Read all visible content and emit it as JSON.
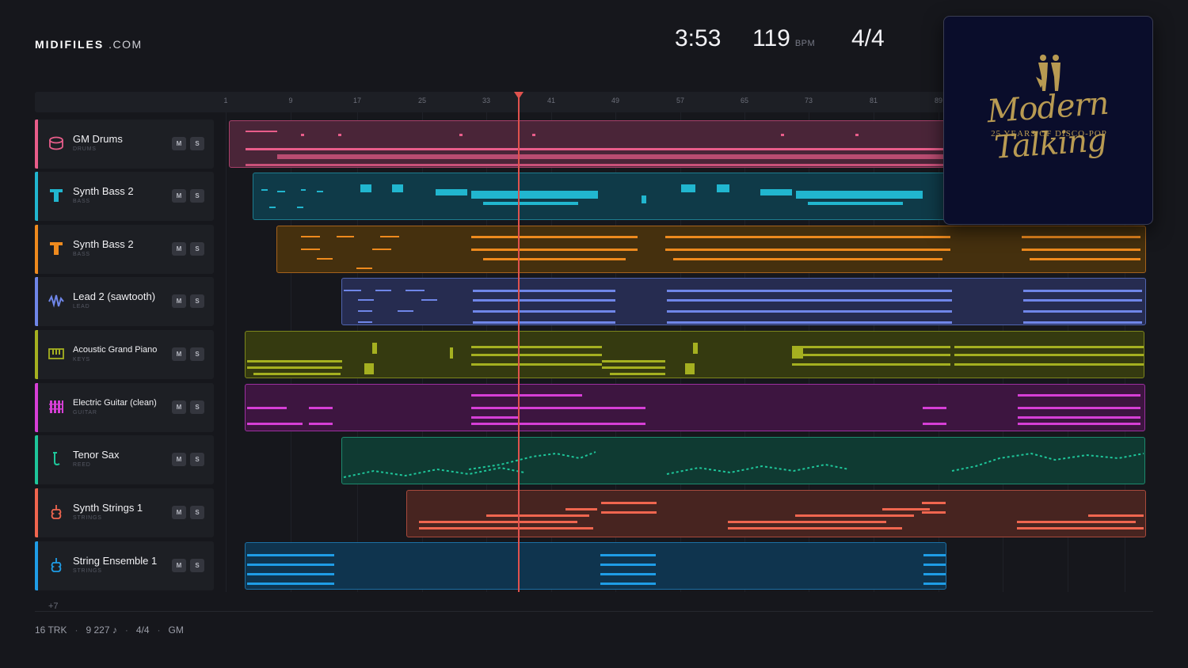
{
  "brand": {
    "name": "MIDIFILES",
    "domain": ".COM"
  },
  "song": {
    "duration": "3:53",
    "bpm": "119",
    "bpm_unit": "BPM",
    "time_signature": "4/4"
  },
  "ruler": {
    "bars": [
      "1",
      "9",
      "17",
      "25",
      "33",
      "41",
      "49",
      "57",
      "65",
      "73",
      "81",
      "89"
    ]
  },
  "tracks": [
    {
      "name": "GM Drums",
      "category": "DRUMS",
      "color": "#e85d8a",
      "icon": "drum-icon"
    },
    {
      "name": "Synth Bass 2",
      "category": "BASS",
      "color": "#21b6cf",
      "icon": "bass-icon"
    },
    {
      "name": "Synth Bass 2",
      "category": "BASS",
      "color": "#ee8a1e",
      "icon": "bass-icon"
    },
    {
      "name": "Lead 2 (sawtooth)",
      "category": "LEAD",
      "color": "#6f86e8",
      "icon": "waveform-icon"
    },
    {
      "name": "Acoustic Grand Piano",
      "category": "KEYS",
      "color": "#a5b020",
      "icon": "piano-icon"
    },
    {
      "name": "Electric Guitar (clean)",
      "category": "GUITAR",
      "color": "#d63fd6",
      "icon": "guitar-fretboard-icon"
    },
    {
      "name": "Tenor Sax",
      "category": "REED",
      "color": "#1ec69a",
      "icon": "saxophone-icon"
    },
    {
      "name": "Synth Strings 1",
      "category": "STRINGS",
      "color": "#f0664f",
      "icon": "violin-icon"
    },
    {
      "name": "String Ensemble 1",
      "category": "STRINGS",
      "color": "#1f9de6",
      "icon": "violin-icon"
    }
  ],
  "buttons": {
    "mute": "M",
    "solo": "S"
  },
  "more_tracks": "+7",
  "footer": {
    "tracks": "16 TRK",
    "notes": "9 227 ♪",
    "signature": "4/4",
    "standard": "GM"
  },
  "album": {
    "artist_logo": "Modern Talking",
    "subtitle": "25 YEARS OF DISCO-POP"
  },
  "playhead_bar": 37
}
